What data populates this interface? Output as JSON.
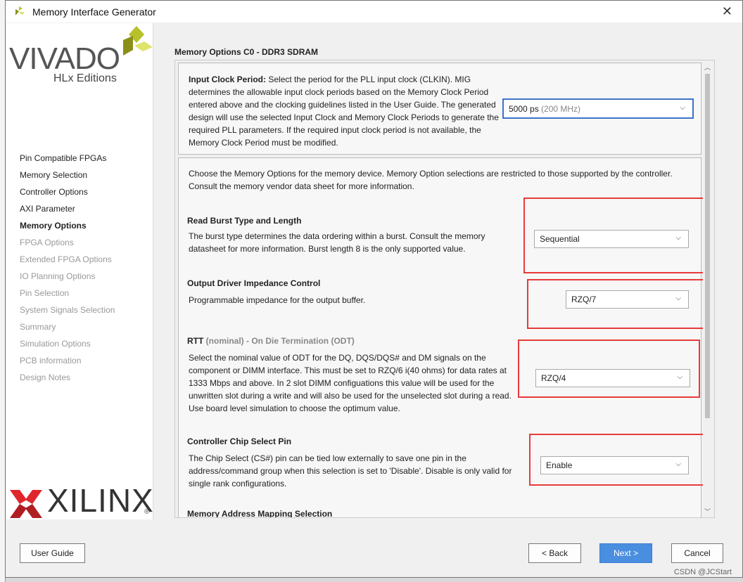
{
  "window": {
    "title": "Memory Interface Generator",
    "close": "✕"
  },
  "branding": {
    "vivado": "VIVADO",
    "hlx": "HLx Editions",
    "xilinx": "XILINX",
    "registered": "®"
  },
  "nav": [
    {
      "label": "Pin Compatible FPGAs",
      "state": "done"
    },
    {
      "label": "Memory Selection",
      "state": "done"
    },
    {
      "label": "Controller Options",
      "state": "done"
    },
    {
      "label": "AXI Parameter",
      "state": "done"
    },
    {
      "label": "Memory Options",
      "state": "active"
    },
    {
      "label": "FPGA Options",
      "state": "disabled"
    },
    {
      "label": "Extended FPGA Options",
      "state": "disabled"
    },
    {
      "label": "IO Planning Options",
      "state": "disabled"
    },
    {
      "label": "Pin Selection",
      "state": "disabled"
    },
    {
      "label": "System Signals Selection",
      "state": "disabled"
    },
    {
      "label": "Summary",
      "state": "disabled"
    },
    {
      "label": "Simulation Options",
      "state": "disabled"
    },
    {
      "label": "PCB information",
      "state": "disabled"
    },
    {
      "label": "Design Notes",
      "state": "disabled"
    }
  ],
  "main": {
    "heading": "Memory Options C0 - DDR3 SDRAM",
    "input_clock": {
      "label": "Input Clock Period:",
      "text": " Select the period for the PLL input clock (CLKIN). MIG determines the allowable input clock periods based on the Memory Clock Period entered above and the clocking guidelines listed in the User Guide. The generated design will use the selected Input Clock and Memory Clock Periods to generate the required PLL parameters. If the required input clock period is not available, the Memory Clock Period must be modified.",
      "value": "5000 ps",
      "value_hint": "(200 MHz)"
    },
    "intro": "Choose the Memory Options for the memory device. Memory Option selections are restricted to those supported by the controller. Consult the memory vendor data sheet for more information.",
    "burst": {
      "title": "Read Burst Type and Length",
      "text": "The burst type determines the data ordering within a burst. Consult the memory datasheet for more information. Burst length 8 is the only supported value.",
      "value": "Sequential"
    },
    "odic": {
      "title": "Output Driver Impedance Control",
      "text": "Programmable impedance for the output buffer.",
      "value": "RZQ/7"
    },
    "rtt": {
      "title": "RTT",
      "title_hint": "(nominal) - On Die Termination (ODT)",
      "text": "Select the nominal value of ODT for the DQ, DQS/DQS# and DM signals on the component or DIMM interface. This must be set to RZQ/6 i(40 ohms) for data rates at 1333 Mbps and above. In 2 slot DIMM configuations this value will be used for the unwritten slot during a write and will also be used for the unselected slot during a read. Use board level simulation to choose the optimum value.",
      "value": "RZQ/4"
    },
    "cs": {
      "title": "Controller Chip Select Pin",
      "text": "The Chip Select (CS#) pin can be tied low externally to save one pin in the address/command group when this selection is set to 'Disable'. Disable is only valid for single rank configurations.",
      "value": "Enable"
    },
    "next_section": "Memory Address Mapping Selection"
  },
  "buttons": {
    "user_guide": "User Guide",
    "back": "< Back",
    "next": "Next >",
    "cancel": "Cancel"
  },
  "watermark": "CSDN @JCStart",
  "colors": {
    "accent": "#4a8ee0",
    "highlight": "#e83a3a"
  }
}
